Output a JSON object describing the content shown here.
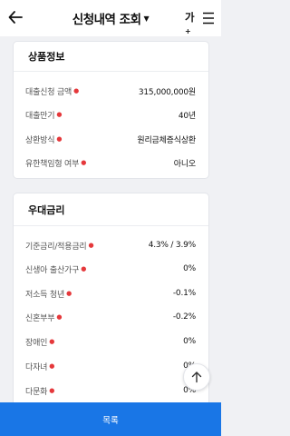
{
  "header": {
    "title": "신청내역 조회",
    "font_size_label": "가",
    "font_size_sup": "+"
  },
  "product_info": {
    "title": "상품정보",
    "rows": [
      {
        "label": "대출신청 금액",
        "value": "315,000,000원"
      },
      {
        "label": "대출만기",
        "value": "40년"
      },
      {
        "label": "상환방식",
        "value": "원리금체증식상환"
      },
      {
        "label": "유한책임형 여부",
        "value": "아니오"
      }
    ]
  },
  "preferential_rate": {
    "title": "우대금리",
    "rows": [
      {
        "label": "기준금리/적용금리",
        "value": "4.3% / 3.9%"
      },
      {
        "label": "신생아 출산가구",
        "value": "0%"
      },
      {
        "label": "저소득 청년",
        "value": "-0.1%"
      },
      {
        "label": "신혼부부",
        "value": "-0.2%"
      },
      {
        "label": "장애인",
        "value": "0%"
      },
      {
        "label": "다자녀",
        "value": "0%"
      },
      {
        "label": "다문화",
        "value": "0%"
      }
    ]
  },
  "bottom_button": {
    "label": "목록"
  },
  "colors": {
    "primary": "#1976e6",
    "required": "#e5383b",
    "background": "#f0f1f4"
  }
}
